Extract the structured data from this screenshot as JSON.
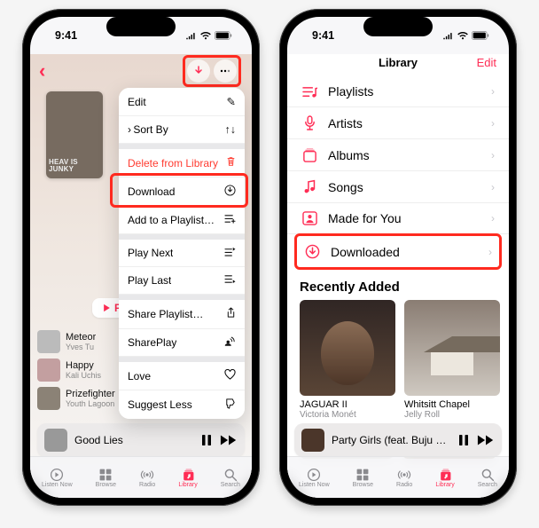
{
  "status": {
    "time": "9:41",
    "indicators": "􀙇 􀛨"
  },
  "screen1": {
    "album_text": "HEAV IS JUNKY",
    "play_label": "Play",
    "menu": {
      "edit": "Edit",
      "sort_by": "Sort By",
      "delete": "Delete from Library",
      "download": "Download",
      "add_playlist": "Add to a Playlist…",
      "play_next": "Play Next",
      "play_last": "Play Last",
      "share_playlist": "Share Playlist…",
      "shareplay": "SharePlay",
      "love": "Love",
      "suggest_less": "Suggest Less"
    },
    "songs": [
      {
        "title": "Meteor",
        "artist": "Yves Tu"
      },
      {
        "title": "Happy",
        "artist": "Kali Uchis"
      },
      {
        "title": "Prizefighter",
        "artist": "Youth Lagoon"
      }
    ],
    "now_playing": "Good Lies"
  },
  "screen2": {
    "title": "Library",
    "edit": "Edit",
    "rows": {
      "playlists": "Playlists",
      "artists": "Artists",
      "albums": "Albums",
      "songs": "Songs",
      "made_for_you": "Made for You",
      "downloaded": "Downloaded"
    },
    "recently_added": "Recently Added",
    "albums": [
      {
        "title": "JAGUAR II",
        "artist": "Victoria Monét"
      },
      {
        "title": "Whitsitt Chapel",
        "artist": "Jelly Roll"
      }
    ],
    "now_playing": "Party Girls (feat. Buju Banto…"
  },
  "tabs": {
    "listen_now": "Listen Now",
    "browse": "Browse",
    "radio": "Radio",
    "library": "Library",
    "search": "Search"
  }
}
